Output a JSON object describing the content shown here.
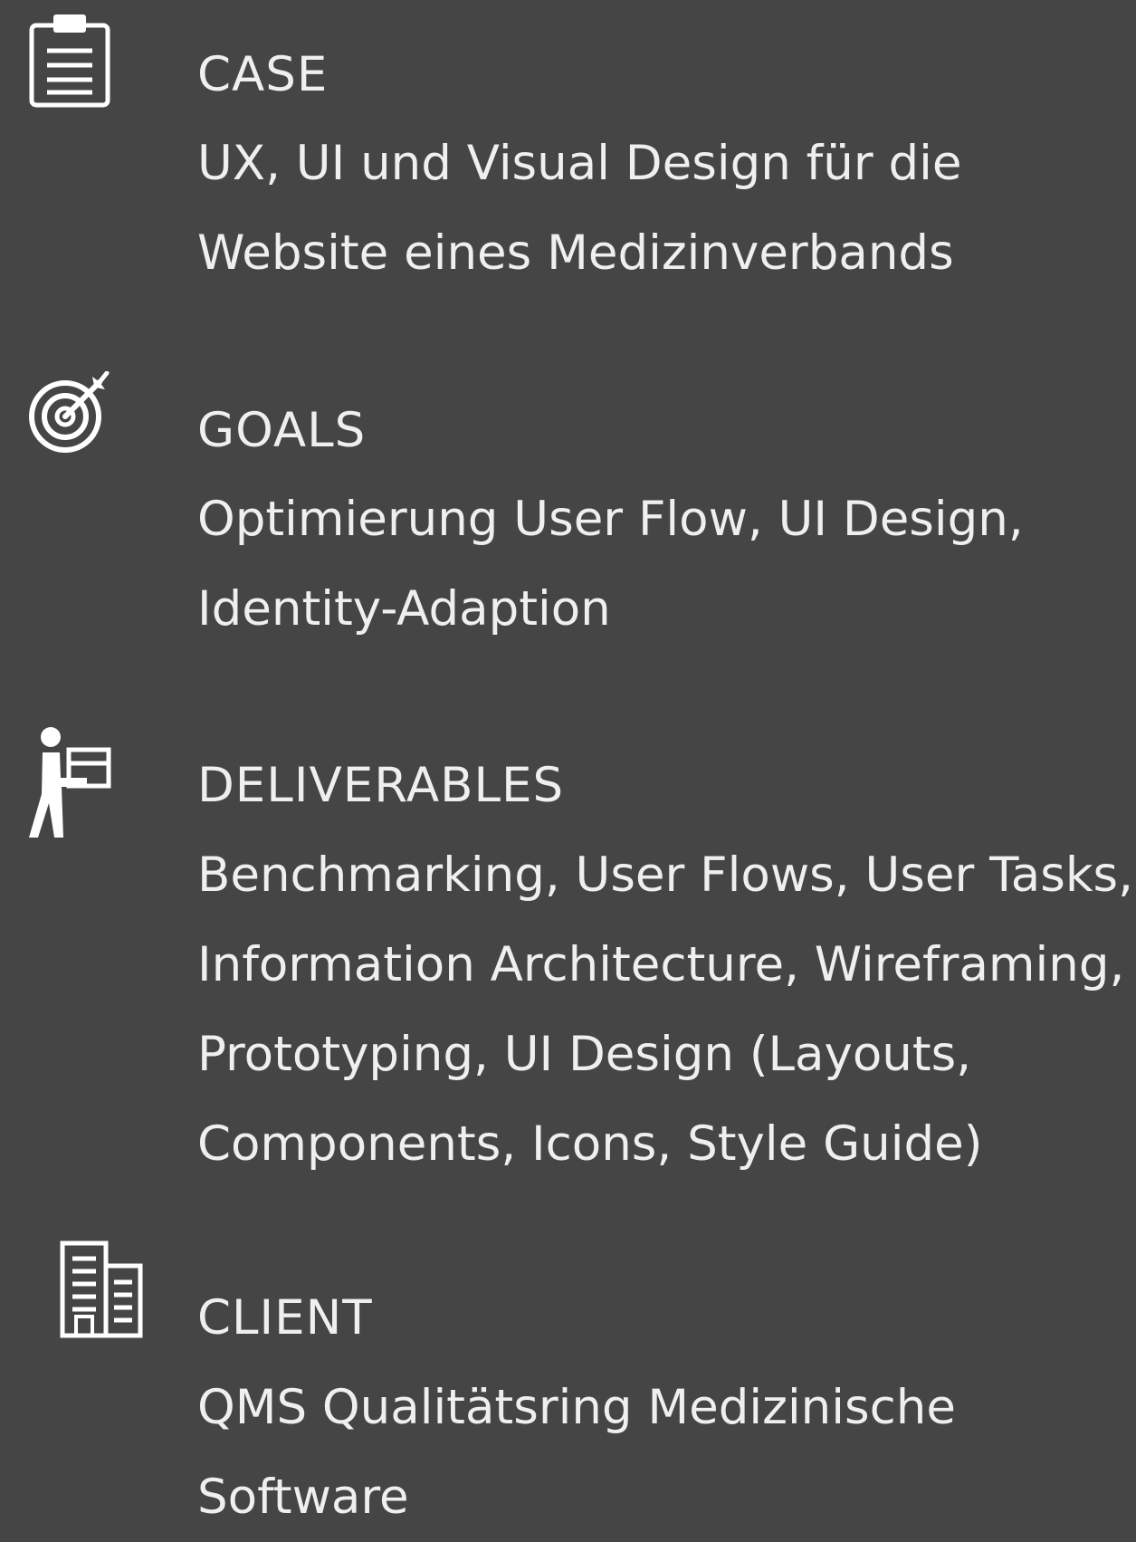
{
  "sections": [
    {
      "icon": "clipboard-icon",
      "heading": "CASE",
      "lines": [
        "UX, UI und Visual Design für die",
        "Website eines Medizinverbands"
      ]
    },
    {
      "icon": "target-icon",
      "heading": "GOALS",
      "lines": [
        "Optimierung User Flow, UI Design,",
        "Identity-Adaption"
      ]
    },
    {
      "icon": "delivery-person-icon",
      "heading": "DELIVERABLES",
      "lines": [
        "Benchmarking, User Flows, User Tasks,",
        "Information Architecture, Wireframing,",
        "Prototyping, UI Design (Layouts,",
        "Components, Icons, Style Guide)"
      ]
    },
    {
      "icon": "office-building-icon",
      "heading": "CLIENT",
      "lines": [
        "QMS Qualitätsring Medizinische",
        "Software"
      ]
    }
  ],
  "colors": {
    "background": "#454545",
    "text": "#efefef",
    "icon": "#ffffff"
  }
}
